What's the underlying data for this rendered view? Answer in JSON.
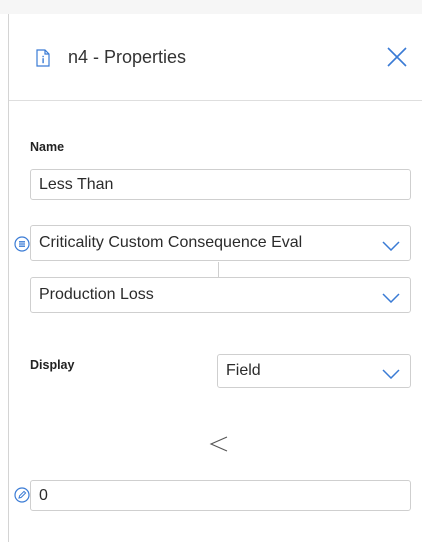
{
  "header": {
    "title": "n4 - Properties",
    "doc_icon": "document-info-icon",
    "close_icon": "close-icon"
  },
  "name_section": {
    "label": "Name",
    "value": "Less Than"
  },
  "query_source": {
    "selected": "Criticality Custom Consequence Eval",
    "icon": "query-source-icon",
    "chevron_icon": "chevron-down-icon"
  },
  "field_select": {
    "selected": "Production Loss",
    "chevron_icon": "chevron-down-icon"
  },
  "display_section": {
    "label": "Display",
    "selected": "Field",
    "chevron_icon": "chevron-down-icon"
  },
  "operator": {
    "icon": "less-than-icon"
  },
  "value_field": {
    "value": "0",
    "icon": "edit-value-icon"
  },
  "colors": {
    "accent": "#3a7bd5",
    "border": "#cfcfcf",
    "text": "#2b2b2b"
  }
}
